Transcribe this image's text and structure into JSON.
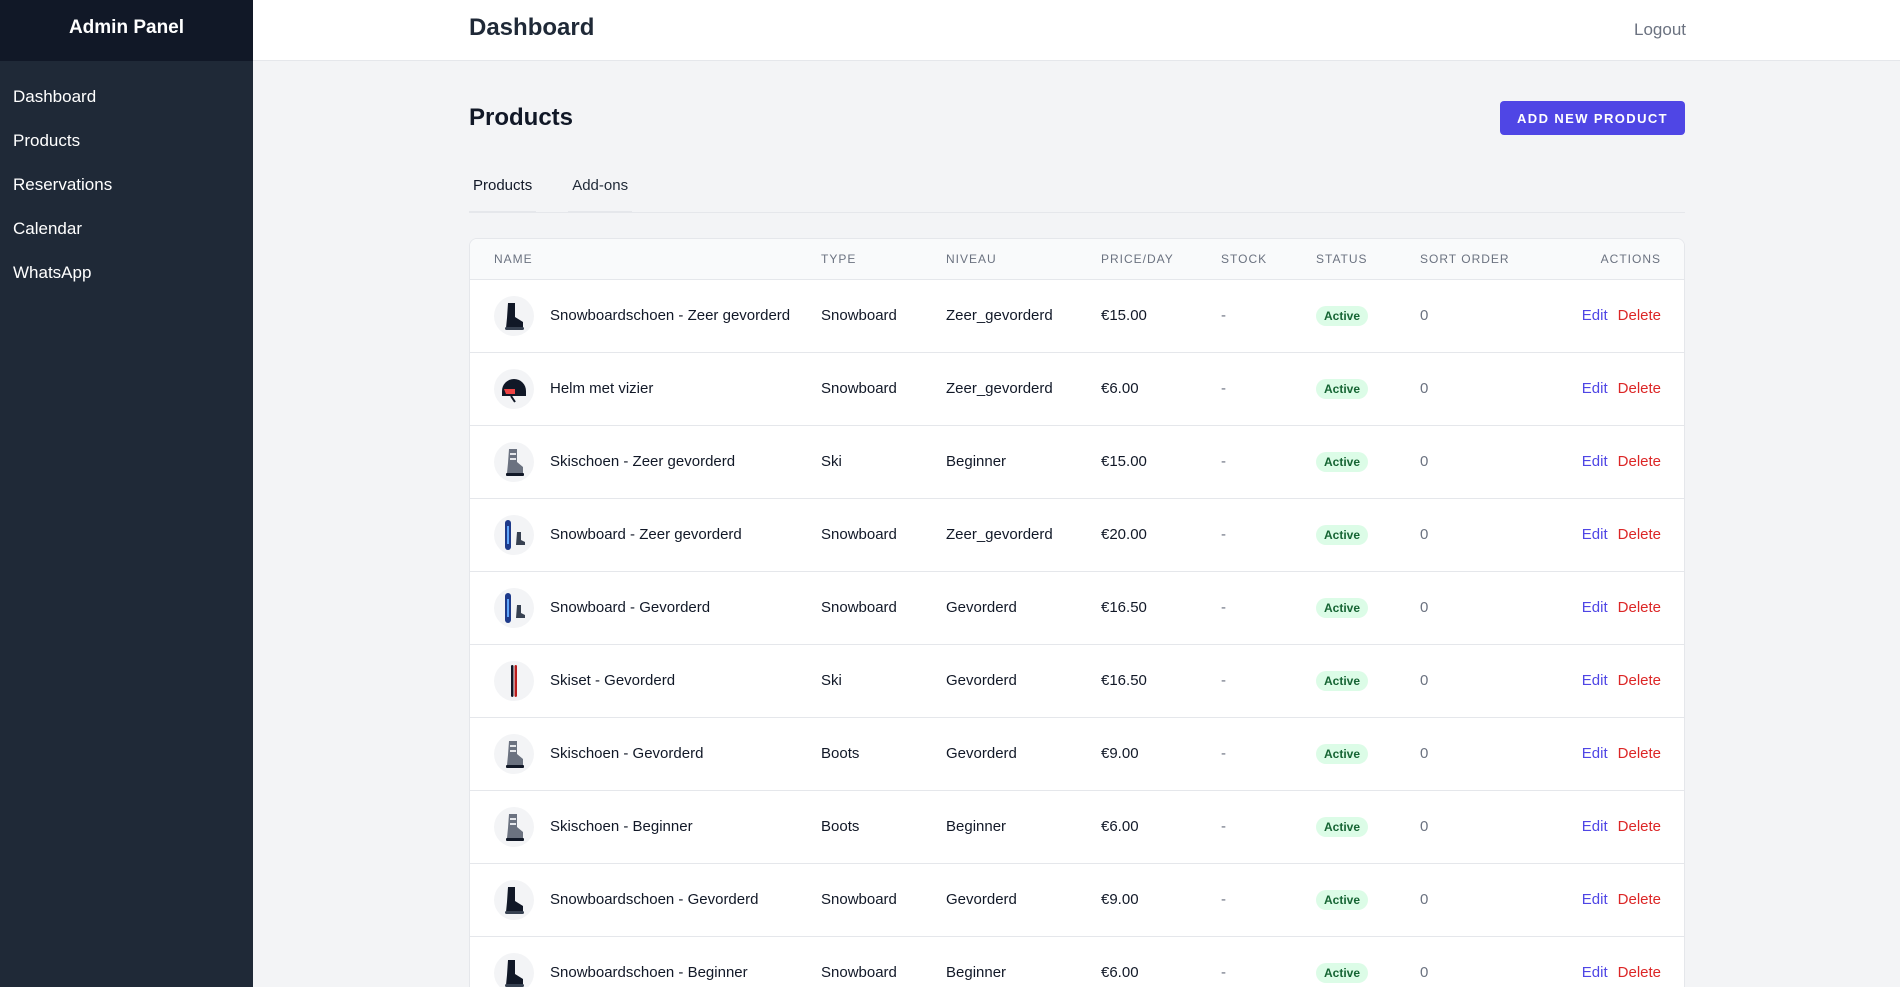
{
  "sidebar": {
    "brand": "Admin Panel",
    "items": [
      {
        "label": "Dashboard"
      },
      {
        "label": "Products"
      },
      {
        "label": "Reservations"
      },
      {
        "label": "Calendar"
      },
      {
        "label": "WhatsApp"
      }
    ]
  },
  "header": {
    "title": "Dashboard",
    "logout": "Logout"
  },
  "main": {
    "title": "Products",
    "add_button": "ADD NEW PRODUCT",
    "tabs": [
      {
        "label": "Products"
      },
      {
        "label": "Add-ons"
      }
    ]
  },
  "table": {
    "columns": [
      "NAME",
      "TYPE",
      "NIVEAU",
      "PRICE/DAY",
      "STOCK",
      "STATUS",
      "SORT ORDER",
      "ACTIONS"
    ],
    "rows": [
      {
        "name": "Snowboardschoen - Zeer gevorderd",
        "type": "Snowboard",
        "niveau": "Zeer_gevorderd",
        "price": "€15.00",
        "stock": "-",
        "status": "Active",
        "sort": "0",
        "icon": "boot-icon"
      },
      {
        "name": "Helm met vizier",
        "type": "Snowboard",
        "niveau": "Zeer_gevorderd",
        "price": "€6.00",
        "stock": "-",
        "status": "Active",
        "sort": "0",
        "icon": "helmet-icon"
      },
      {
        "name": "Skischoen - Zeer gevorderd",
        "type": "Ski",
        "niveau": "Beginner",
        "price": "€15.00",
        "stock": "-",
        "status": "Active",
        "sort": "0",
        "icon": "ski-boot-icon"
      },
      {
        "name": "Snowboard - Zeer gevorderd",
        "type": "Snowboard",
        "niveau": "Zeer_gevorderd",
        "price": "€20.00",
        "stock": "-",
        "status": "Active",
        "sort": "0",
        "icon": "snowboard-icon"
      },
      {
        "name": "Snowboard - Gevorderd",
        "type": "Snowboard",
        "niveau": "Gevorderd",
        "price": "€16.50",
        "stock": "-",
        "status": "Active",
        "sort": "0",
        "icon": "snowboard-icon"
      },
      {
        "name": "Skiset - Gevorderd",
        "type": "Ski",
        "niveau": "Gevorderd",
        "price": "€16.50",
        "stock": "-",
        "status": "Active",
        "sort": "0",
        "icon": "ski-icon"
      },
      {
        "name": "Skischoen - Gevorderd",
        "type": "Boots",
        "niveau": "Gevorderd",
        "price": "€9.00",
        "stock": "-",
        "status": "Active",
        "sort": "0",
        "icon": "ski-boot-icon"
      },
      {
        "name": "Skischoen - Beginner",
        "type": "Boots",
        "niveau": "Beginner",
        "price": "€6.00",
        "stock": "-",
        "status": "Active",
        "sort": "0",
        "icon": "ski-boot-icon"
      },
      {
        "name": "Snowboardschoen - Gevorderd",
        "type": "Snowboard",
        "niveau": "Gevorderd",
        "price": "€9.00",
        "stock": "-",
        "status": "Active",
        "sort": "0",
        "icon": "boot-icon"
      },
      {
        "name": "Snowboardschoen - Beginner",
        "type": "Snowboard",
        "niveau": "Beginner",
        "price": "€6.00",
        "stock": "-",
        "status": "Active",
        "sort": "0",
        "icon": "boot-icon"
      }
    ],
    "actions": {
      "edit": "Edit",
      "delete": "Delete"
    }
  },
  "colors": {
    "sidebar_bg": "#1f2937",
    "brand_bg": "#111827",
    "accent": "#4f46e5",
    "danger": "#dc2626",
    "success_text": "#166534",
    "success_bg": "#dcfce7"
  }
}
